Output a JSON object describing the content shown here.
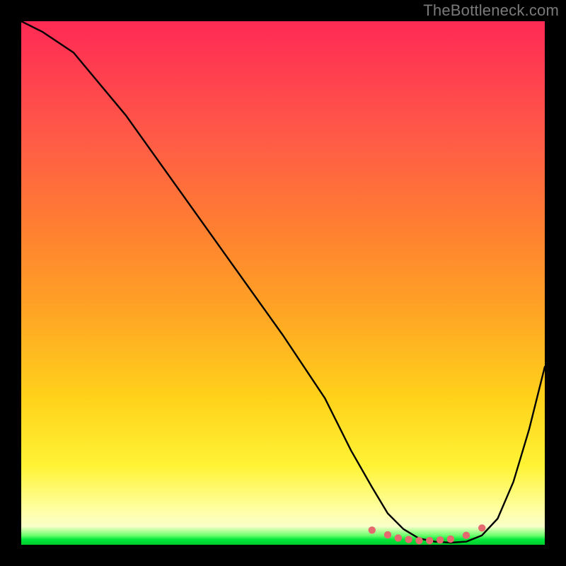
{
  "watermark": "TheBottleneck.com",
  "chart_data": {
    "type": "line",
    "title": "",
    "xlabel": "",
    "ylabel": "",
    "xlim": [
      0,
      100
    ],
    "ylim": [
      0,
      100
    ],
    "series": [
      {
        "name": "curve",
        "x": [
          0,
          4,
          10,
          20,
          30,
          40,
          50,
          58,
          63,
          67,
          70,
          73,
          76,
          79,
          82,
          85,
          88,
          91,
          94,
          97,
          100
        ],
        "y": [
          100,
          98,
          94,
          82,
          68,
          54,
          40,
          28,
          18,
          11,
          6,
          3,
          1.2,
          0.6,
          0.4,
          0.6,
          1.8,
          5,
          12,
          22,
          34
        ]
      }
    ],
    "markers": {
      "name": "bottom-dots",
      "x": [
        67,
        70,
        72,
        74,
        76,
        78,
        80,
        82,
        85,
        88
      ],
      "y": [
        2.8,
        1.9,
        1.3,
        1.0,
        0.8,
        0.8,
        0.9,
        1.1,
        1.8,
        3.2
      ]
    },
    "background_gradient": {
      "direction": "vertical",
      "stops": [
        {
          "pos": 0.0,
          "color": "#ff2a55"
        },
        {
          "pos": 0.4,
          "color": "#ff8030"
        },
        {
          "pos": 0.72,
          "color": "#ffd21a"
        },
        {
          "pos": 0.93,
          "color": "#ffff9e"
        },
        {
          "pos": 0.99,
          "color": "#00e838"
        }
      ]
    }
  }
}
